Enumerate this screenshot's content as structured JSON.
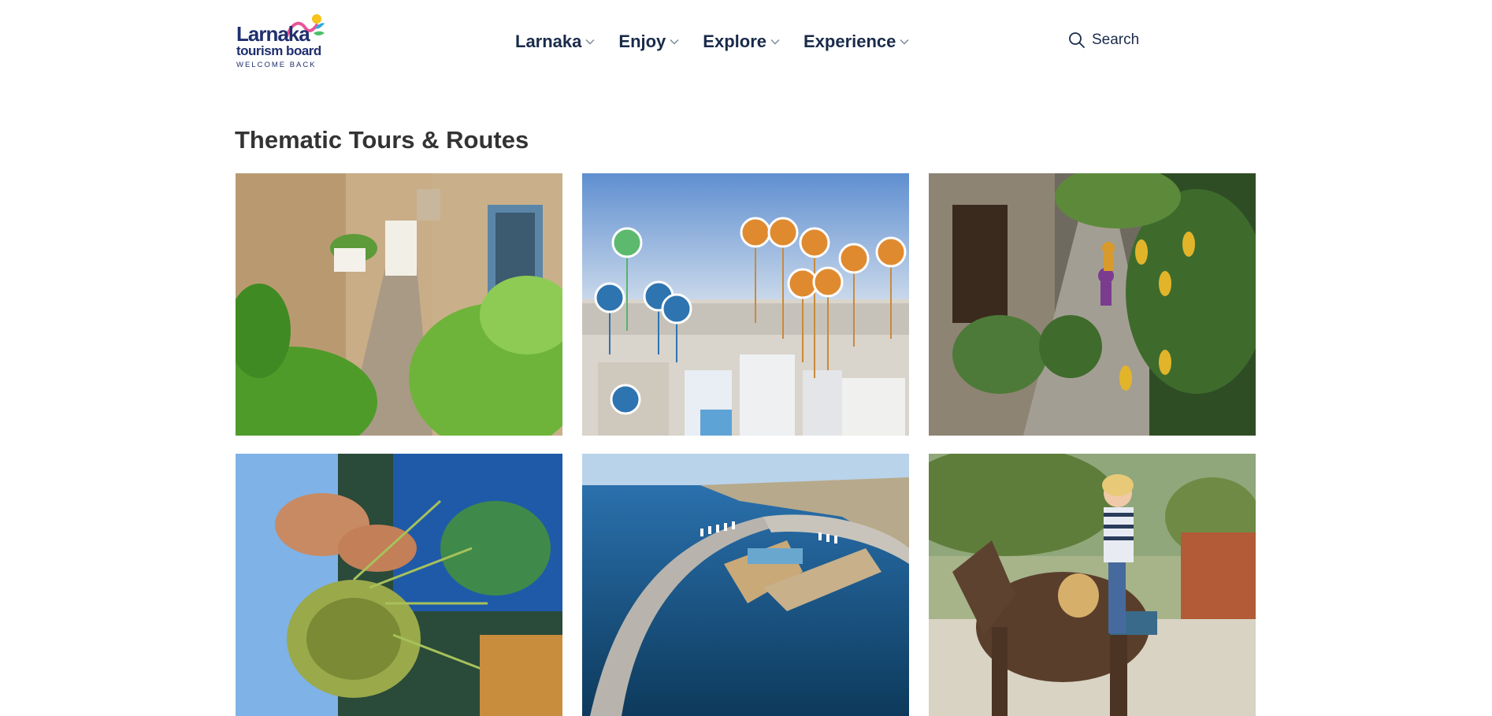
{
  "logo": {
    "word": "Larnaka",
    "sub": "tourism board",
    "tagline": "WELCOME BACK"
  },
  "nav": {
    "items": [
      {
        "label": "Larnaka",
        "icon": "chevron-down-icon"
      },
      {
        "label": "Enjoy",
        "icon": "chevron-down-icon"
      },
      {
        "label": "Explore",
        "icon": "chevron-down-icon"
      },
      {
        "label": "Experience",
        "icon": "chevron-down-icon"
      }
    ]
  },
  "search": {
    "label": "Search",
    "icon": "search-icon"
  },
  "section": {
    "title": "Thematic Tours & Routes"
  },
  "cards": [
    {
      "image": "village-alley-with-plants"
    },
    {
      "image": "city-aerial-with-map-pins"
    },
    {
      "image": "cyclists-in-stone-alley"
    },
    {
      "image": "hands-weaving-basket"
    },
    {
      "image": "marina-aerial-view"
    },
    {
      "image": "woman-riding-donkey"
    }
  ],
  "colors": {
    "brand_navy": "#1f2f6e",
    "heading": "#333333",
    "nav_text": "#1a2b4a"
  }
}
